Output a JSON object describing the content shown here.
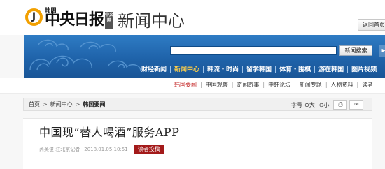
{
  "header": {
    "logo_icon": "J",
    "logo_korea": "韩国",
    "logo_main": "中央日报",
    "logo_badge": "中文网",
    "logo_sub": "新闻中心",
    "back_button": "返回首页"
  },
  "banner": {
    "search_placeholder": "",
    "search_button": "新闻搜索",
    "nav": [
      {
        "label": "财经新闻",
        "active": false
      },
      {
        "label": "新闻中心",
        "active": true
      },
      {
        "label": "韩流・时尚",
        "active": false
      },
      {
        "label": "留学韩国",
        "active": false
      },
      {
        "label": "体育・围棋",
        "active": false
      },
      {
        "label": "游在韩国",
        "active": false
      },
      {
        "label": "图片视频",
        "active": false
      }
    ]
  },
  "subnav": {
    "items": [
      {
        "label": "韩国要闻",
        "active": true
      },
      {
        "label": "中国观察",
        "active": false
      },
      {
        "label": "奇闻奇事",
        "active": false
      },
      {
        "label": "中韩论坛",
        "active": false
      },
      {
        "label": "新闻专题",
        "active": false
      },
      {
        "label": "人物资料",
        "active": false
      },
      {
        "label": "读者",
        "active": false
      }
    ]
  },
  "breadcrumb": {
    "items": [
      "首页",
      "新闻中心",
      "韩国要闻"
    ],
    "font_label": "字号",
    "font_larger": "大",
    "font_smaller": "小",
    "print_icon": "print-icon",
    "email_icon": "email-icon"
  },
  "article": {
    "title": "中国现“替人喝酒”服务APP",
    "author": "芮英俊 驻北京记者",
    "date": "2018.01.05 10:51",
    "submit_button": "读者投稿"
  },
  "colors": {
    "banner_blue": "#1f63aa",
    "active_nav": "#ffd04a",
    "active_subnav": "#c21f1f",
    "submit_red": "#a31a1a",
    "logo_ring": "#f2a000"
  }
}
